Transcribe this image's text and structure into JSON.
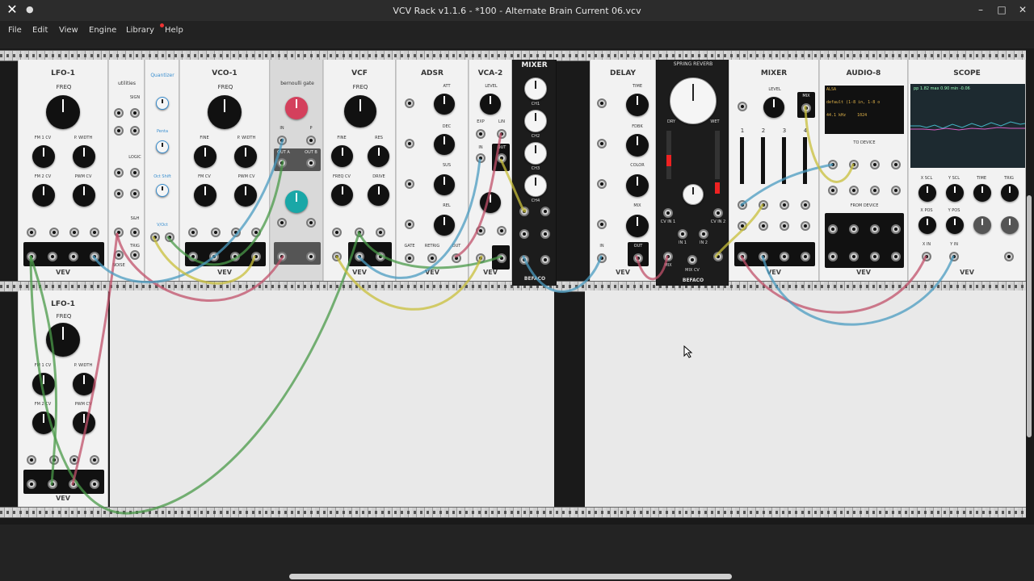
{
  "window": {
    "title": "VCV Rack v1.1.6 - *100 - Alternate Brain Current 06.vcv",
    "close_icon": "close-icon",
    "minimize_icon": "minimize-icon",
    "maximize_icon": "maximize-icon"
  },
  "menu": {
    "items": [
      "File",
      "Edit",
      "View",
      "Engine",
      "Library",
      "Help"
    ]
  },
  "modules": {
    "lfo1_top": {
      "name": "LFO-1",
      "freq": "FREQ",
      "fm1": "FM 1 CV",
      "pwidth": "P. WIDTH",
      "fm2": "FM 2 CV",
      "pwm": "PWM CV",
      "maker": "VEV"
    },
    "utilities": {
      "name": "utilities",
      "sign": "SIGN",
      "logic": "LOGIC",
      "sh": "S&H",
      "noise": "NOISE",
      "trig": "TRIG"
    },
    "quantizer": {
      "name": "Quantizer",
      "penta": "Penta",
      "oct_shift": "Oct Shift",
      "voct": "V/Oct"
    },
    "vco1": {
      "name": "VCO-1",
      "freq": "FREQ",
      "fine": "FINE",
      "pwidth": "P. WIDTH",
      "fm": "FM CV",
      "pwm": "PWM CV",
      "maker": "VEV"
    },
    "bernoulli": {
      "name": "bernoulli gate",
      "in": "IN",
      "p": "P",
      "outa": "OUT A",
      "outb": "OUT B"
    },
    "vcf": {
      "name": "VCF",
      "freq": "FREQ",
      "fine": "FINE",
      "res": "RES",
      "freqcv": "FREQ CV",
      "drive": "DRIVE",
      "maker": "VEV"
    },
    "adsr": {
      "name": "ADSR",
      "att": "ATT",
      "dec": "DEC",
      "sus": "SUS",
      "rel": "REL",
      "gate": "GATE",
      "retrig": "RETRIG",
      "out": "OUT",
      "maker": "VEV"
    },
    "vca2": {
      "name": "VCA-2",
      "level": "LEVEL",
      "exp": "EXP",
      "lin": "LIN",
      "in": "IN",
      "out": "OUT",
      "maker": "VEV"
    },
    "mixer_dark": {
      "name": "MIXER",
      "ch1": "CH1",
      "ch2": "CH2",
      "ch3": "CH3",
      "ch4": "CH4",
      "maker": "BEFACO"
    },
    "delay": {
      "name": "DELAY",
      "time": "TIME",
      "fdbk": "FDBK",
      "color": "COLOR",
      "mix": "MIX",
      "in": "IN",
      "out": "OUT",
      "maker": "VEV"
    },
    "spring": {
      "name": "SPRING REVERB",
      "dry": "DRY",
      "wet": "WET",
      "cvin1": "CV IN 1",
      "cvin2": "CV IN 2",
      "in1": "IN 1",
      "in2": "IN 2",
      "mixcv": "MIX CV",
      "mix": "MIX",
      "maker": "BEFACO"
    },
    "mixer_vev": {
      "name": "MIXER",
      "level": "LEVEL",
      "mix": "MIX",
      "ch_labels": [
        "1",
        "2",
        "3",
        "4"
      ],
      "maker": "VEV"
    },
    "audio8": {
      "name": "AUDIO-8",
      "driver": "ALSA",
      "device": "default (1-8 in, 1-8 o",
      "rate": "44.1 kHz",
      "block": "1024",
      "to_device": "TO DEVICE",
      "from_device": "FROM DEVICE",
      "maker": "VEV"
    },
    "scope": {
      "name": "SCOPE",
      "xscl": "X SCL",
      "yscl": "Y SCL",
      "time": "TIME",
      "trig": "TRIG",
      "xpos": "X POS",
      "ypos": "Y POS",
      "xin": "X IN",
      "yin": "Y IN",
      "readout": "pp 1.82  max 0.90  min -0.06",
      "maker": "VEV"
    },
    "lfo1_bottom": {
      "name": "LFO-1",
      "freq": "FREQ",
      "fm1": "FM 1 CV",
      "pwidth": "P. WIDTH",
      "fm2": "FM 2 CV",
      "pwm": "PWM CV",
      "maker": "VEV"
    }
  },
  "cable_colors": {
    "green": "#4a9a48",
    "pink": "#c0506a",
    "blue": "#4a9bc0",
    "yellow": "#c8bf3a"
  }
}
